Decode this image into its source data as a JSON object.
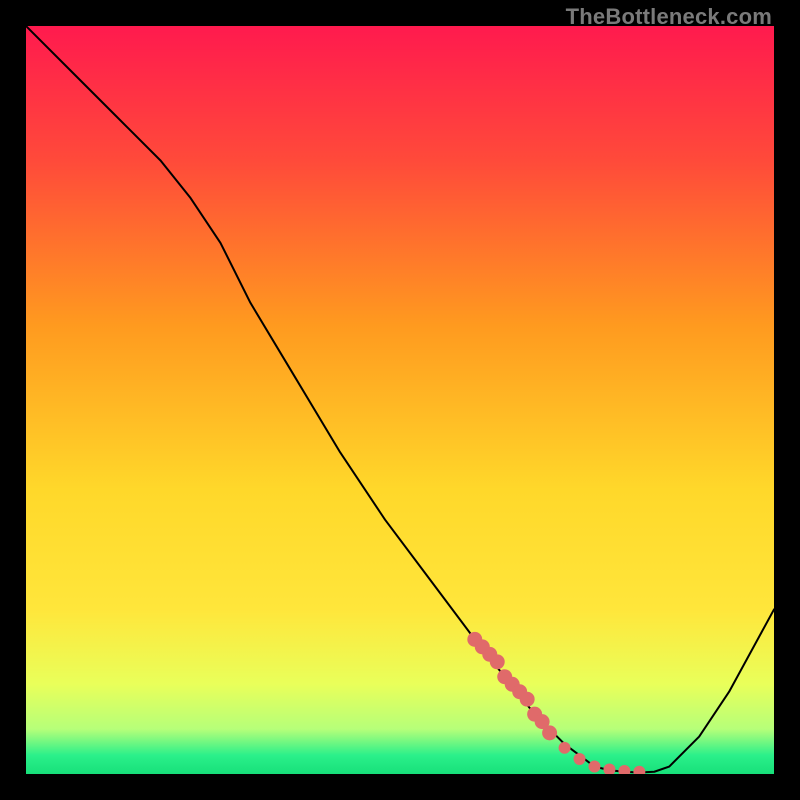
{
  "watermark": "TheBottleneck.com",
  "colors": {
    "frame_bg_black": "#000000",
    "gradient_top": "#ff1a4e",
    "gradient_mid_orange": "#ff9a1f",
    "gradient_mid_yellow": "#ffe63b",
    "gradient_lower_yellowgreen": "#e9ff5a",
    "gradient_green_pale": "#b6ff79",
    "gradient_green": "#2bf08a",
    "gradient_base": "#17e07a",
    "curve_stroke": "#000000",
    "marker_fill": "#e06a6a",
    "marker_stroke": "#e06a6a"
  },
  "chart_data": {
    "type": "line",
    "title": "",
    "xlabel": "",
    "ylabel": "",
    "xlim": [
      0,
      100
    ],
    "ylim": [
      0,
      100
    ],
    "notes": "Axes have no tick labels or numeric annotations; values are normalized 0–100 estimates read from pixel positions.",
    "series": [
      {
        "name": "bottleneck-curve",
        "x": [
          0,
          6,
          12,
          18,
          22,
          26,
          30,
          36,
          42,
          48,
          54,
          60,
          64,
          68,
          72,
          76,
          78,
          80,
          82,
          84,
          86,
          90,
          94,
          100
        ],
        "y": [
          100,
          94,
          88,
          82,
          77,
          71,
          63,
          53,
          43,
          34,
          26,
          18,
          13,
          8,
          4,
          1,
          0.5,
          0.3,
          0.2,
          0.3,
          1,
          5,
          11,
          22
        ]
      }
    ],
    "markers": {
      "name": "highlighted-range",
      "x": [
        60,
        61,
        62,
        63,
        64,
        65,
        66,
        67,
        68,
        69,
        70,
        72,
        74,
        76,
        78,
        80,
        82
      ],
      "y": [
        18,
        17,
        16,
        15,
        13,
        12,
        11,
        10,
        8,
        7,
        5.5,
        3.5,
        2,
        1,
        0.6,
        0.4,
        0.3
      ]
    },
    "background_gradient_stops": [
      {
        "pos": 0.0,
        "color": "#ff1a4e"
      },
      {
        "pos": 0.18,
        "color": "#ff4a3a"
      },
      {
        "pos": 0.4,
        "color": "#ff9a1f"
      },
      {
        "pos": 0.62,
        "color": "#ffd82a"
      },
      {
        "pos": 0.78,
        "color": "#ffe63b"
      },
      {
        "pos": 0.88,
        "color": "#e9ff5a"
      },
      {
        "pos": 0.94,
        "color": "#b6ff79"
      },
      {
        "pos": 0.975,
        "color": "#2bf08a"
      },
      {
        "pos": 1.0,
        "color": "#17e07a"
      }
    ]
  }
}
